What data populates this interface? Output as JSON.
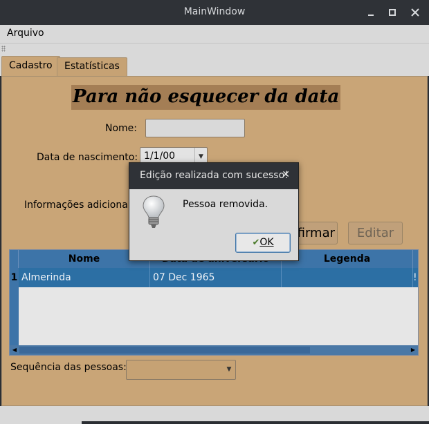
{
  "window": {
    "title": "MainWindow",
    "minimize": "▁",
    "maximize": "▫",
    "close": "✕"
  },
  "menubar": {
    "arquivo": "Arquivo"
  },
  "tabs": [
    {
      "label": "Cadastro",
      "active": true
    },
    {
      "label": "Estatísticas",
      "active": false
    }
  ],
  "form": {
    "heading": "Para não esquecer da data",
    "name_label": "Nome:",
    "name_value": "",
    "birthdate_label": "Data de nascimento:",
    "birthdate_value": "1/1/00",
    "extra_info_label": "Informações adicionai",
    "confirm_button": "firmar",
    "edit_button": "Editar",
    "sequence_label": "Sequência das pessoas:",
    "sequence_value": ""
  },
  "table": {
    "columns": [
      "Nome",
      "Data de aniversário",
      "Legenda"
    ],
    "rows": [
      {
        "num": "1",
        "nome": "Almerinda",
        "data": "07 Dec 1965",
        "legenda": "",
        "extra": "!"
      }
    ]
  },
  "dialog": {
    "title": "Edição realizada com sucesso!",
    "close": "✕",
    "message": "Pessoa removida.",
    "ok_label": "OK",
    "icon": "lightbulb-icon"
  },
  "colors": {
    "panel": "#c9a577",
    "heading_bg": "#a47e55",
    "selection": "#2c6fa4",
    "header": "#3d74a8"
  }
}
